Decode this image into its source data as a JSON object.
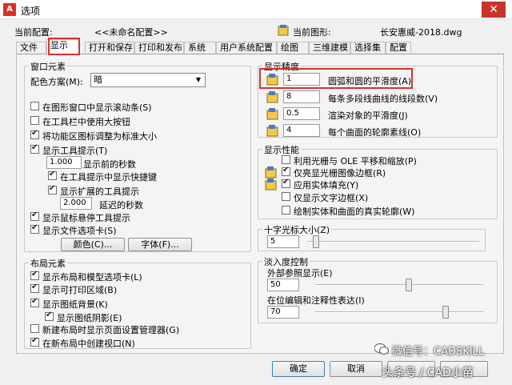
{
  "window": {
    "title": "选项",
    "icon_letter": "A",
    "close_label": "✕"
  },
  "header": {
    "profile_label": "当前配置:",
    "profile_value": "<<未命名配置>>",
    "drawing_label": "当前图形:",
    "drawing_value": "长安惠威-2018.dwg"
  },
  "tabs": [
    "文件",
    "显示",
    "打开和保存",
    "打印和发布",
    "系统",
    "用户系统配置",
    "绘图",
    "三维建模",
    "选择集",
    "配置"
  ],
  "active_tab": "显示",
  "window_elements": {
    "title": "窗口元素",
    "scheme_label": "配色方案(M):",
    "scheme_value": "暗",
    "cb1": "在图形窗口中显示滚动条(S)",
    "cb2": "在工具栏中使用大按钮",
    "cb3": "将功能区图标调整为标准大小",
    "cb4": "显示工具提示(T)",
    "tooltip_delay_value": "1.000",
    "tooltip_delay_label": "显示前的秒数",
    "cb5": "在工具提示中显示快捷键",
    "cb6": "显示扩展的工具提示",
    "ext_delay_value": "2.000",
    "ext_delay_label": "延迟的秒数",
    "cb7": "显示鼠标悬停工具提示",
    "cb8": "显示文件选项卡(S)",
    "colors_button": "颜色(C)...",
    "fonts_button": "字体(F)..."
  },
  "layout_elements": {
    "title": "布局元素",
    "cb1": "显示布局和模型选项卡(L)",
    "cb2": "显示可打印区域(B)",
    "cb3": "显示图纸背景(K)",
    "cb4": "显示图纸阴影(E)",
    "cb5": "新建布局时显示页面设置管理器(G)",
    "cb6": "在新布局中创建视口(N)"
  },
  "resolution": {
    "title": "显示精度",
    "rows": [
      {
        "value": "1",
        "label": "圆弧和圆的平滑度(A)"
      },
      {
        "value": "8",
        "label": "每条多段线曲线的线段数(V)"
      },
      {
        "value": "0.5",
        "label": "渲染对象的平滑度(J)"
      },
      {
        "value": "4",
        "label": "每个曲面的轮廓素线(O)"
      }
    ]
  },
  "performance": {
    "title": "显示性能",
    "items": [
      {
        "label": "利用光栅与 OLE 平移和缩放(P)",
        "checked": false
      },
      {
        "label": "仅亮显光栅图像边框(R)",
        "checked": true
      },
      {
        "label": "应用实体填充(Y)",
        "checked": true
      },
      {
        "label": "仅显示文字边框(X)",
        "checked": false
      },
      {
        "label": "绘制实体和曲面的真实轮廓(W)",
        "checked": false
      }
    ]
  },
  "crosshair": {
    "title": "十字光标大小(Z)",
    "value": "5",
    "level": 5
  },
  "fade": {
    "title": "淡入度控制",
    "xref_label": "外部参照显示(E)",
    "xref_value": "50",
    "xref_level": 50,
    "inplace_label": "在位编辑和注释性表达(I)",
    "inplace_value": "70",
    "inplace_level": 70
  },
  "footer": {
    "ok": "确定",
    "cancel": "取消"
  },
  "watermark": {
    "line1": "微信号：CADSKILL",
    "line2": "头条号 / CAD小苗"
  },
  "colors": {
    "highlight": "#d9312b",
    "titlebar_close": "#c8332a"
  }
}
